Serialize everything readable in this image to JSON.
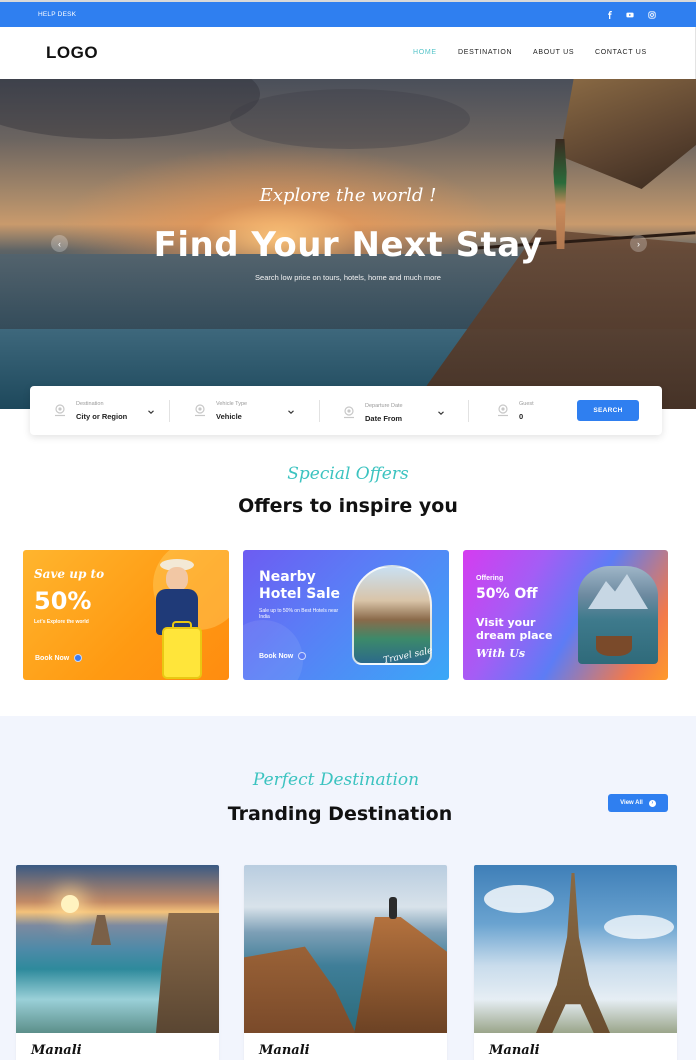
{
  "topbar": {
    "help_desk": "HELP DESK",
    "social": [
      "facebook-icon",
      "youtube-icon",
      "instagram-icon"
    ],
    "color": "#2f7ff0"
  },
  "nav": {
    "logo": "LOGO",
    "links": [
      "HOME",
      "DESTINATION",
      "ABOUT US",
      "CONTACT US"
    ],
    "active": "HOME",
    "active_color": "#56c4c9"
  },
  "hero": {
    "script": "Explore the world !",
    "title": "Find Your Next Stay",
    "subtitle": "Search low price on tours, hotels, home and much more"
  },
  "search": {
    "fields": [
      {
        "label": "Destination",
        "value": "City or Region"
      },
      {
        "label": "Vehicle Type",
        "value": "Vehicle"
      },
      {
        "label": "Departure Date",
        "value": "Date From"
      },
      {
        "label": "Guest",
        "value": "0"
      }
    ],
    "button": "SEARCH"
  },
  "offers": {
    "kicker": "Special Offers",
    "heading": "Offers to inspire you",
    "cards": [
      {
        "line1": "Save up to",
        "line2": "50%",
        "line3": "Let's Explore the world",
        "cta": "Book Now"
      },
      {
        "line1": "Nearby",
        "line2": "Hotel Sale",
        "line3": "Sale up to 50% on Best Hotels near India",
        "cta": "Book Now",
        "sign": "Travel sale"
      },
      {
        "line1": "Offering",
        "line2": "50% Off",
        "line3": "Visit your dream place",
        "line4": "With Us"
      }
    ]
  },
  "destinations": {
    "kicker": "Perfect Destination",
    "heading": "Tranding Destination",
    "view_all": "View All",
    "items": [
      {
        "name": "Manali"
      },
      {
        "name": "Manali"
      },
      {
        "name": "Manali"
      }
    ]
  }
}
